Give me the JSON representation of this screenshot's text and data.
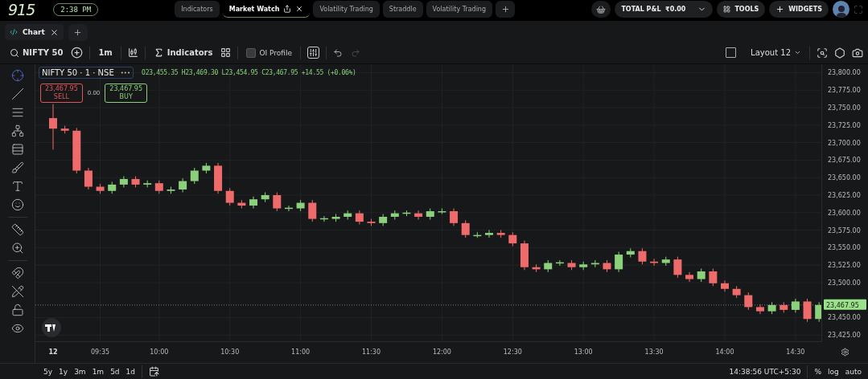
{
  "top_bar": {
    "logo": "915",
    "clock": "2:38 PM",
    "tabs": [
      {
        "label": "Indicators",
        "selected": false
      },
      {
        "label": "Market Watch",
        "selected": true
      },
      {
        "label": "Volatility Trading",
        "selected": false
      },
      {
        "label": "Straddle",
        "selected": false
      },
      {
        "label": "Volatility Trading",
        "selected": false
      }
    ],
    "pnl": {
      "label": "TOTAL P&L",
      "value": "₹0.00"
    },
    "tools": "TOOLS",
    "widgets": "WIDGETS"
  },
  "chart_tabs": [
    {
      "label": "Chart",
      "selected": true
    }
  ],
  "toolbar": {
    "symbol": "NIFTY 50",
    "interval": "1m",
    "indicators": "Indicators",
    "oi_profile": {
      "label": "OI Profile",
      "checked": false
    },
    "redo_disabled": true,
    "layout_checkbox": {
      "checked": false
    },
    "layout": "Layout 12"
  },
  "drawing_tools": [
    {
      "selected": true
    },
    {
      "selected": false
    },
    {
      "selected": false
    },
    {
      "selected": false
    },
    {
      "selected": false
    },
    {
      "selected": false
    },
    {
      "selected": false
    },
    {
      "selected": false
    },
    {
      "selected": false
    },
    {
      "selected": false
    },
    {
      "selected": false
    },
    {
      "selected": false
    },
    {
      "selected": false
    },
    {
      "selected": false
    }
  ],
  "legend": {
    "title": "NIFTY 50 · 1 · NSE",
    "more": "•••",
    "ohlc": "O23,455.35 H23,469.30 L23,454.95 C23,467.95 +14.55 (+0.06%)"
  },
  "trade": {
    "sell_price": "23,467.95",
    "sell_label": "SELL",
    "spread": "0.00",
    "buy_price": "23,467.95",
    "buy_label": "BUY"
  },
  "chart_data": {
    "type": "candlestick",
    "grid": true,
    "x": [
      555,
      560,
      565,
      570,
      575,
      580,
      585,
      590,
      595,
      600,
      605,
      610,
      615,
      620,
      625,
      630,
      635,
      640,
      645,
      650,
      655,
      660,
      665,
      670,
      675,
      680,
      685,
      690,
      695,
      700,
      705,
      710,
      715,
      720,
      725,
      730,
      735,
      740,
      745,
      750,
      755,
      760,
      765,
      770,
      775,
      780,
      785,
      790,
      795,
      800,
      805,
      810,
      815,
      820,
      825,
      830,
      835,
      840,
      845,
      850,
      855,
      860,
      865,
      870,
      875,
      880
    ],
    "xlim": [
      547.5,
      881.3
    ],
    "ohlc": [
      [
        23735,
        23755,
        23690,
        23720
      ],
      [
        23720,
        23724,
        23713,
        23717
      ],
      [
        23717,
        23721,
        23656,
        23660
      ],
      [
        23660,
        23664,
        23633,
        23637
      ],
      [
        23637,
        23641,
        23627,
        23631
      ],
      [
        23631,
        23644,
        23627,
        23640
      ],
      [
        23640,
        23652,
        23636,
        23648
      ],
      [
        23648,
        23652,
        23636,
        23640
      ],
      [
        23640,
        23646,
        23636,
        23642
      ],
      [
        23642,
        23646,
        23627,
        23631
      ],
      [
        23631,
        23637,
        23627,
        23633
      ],
      [
        23633,
        23649,
        23629,
        23645
      ],
      [
        23645,
        23664,
        23641,
        23660
      ],
      [
        23660,
        23671,
        23656,
        23667
      ],
      [
        23667,
        23671,
        23627,
        23631
      ],
      [
        23631,
        23635,
        23610,
        23614
      ],
      [
        23614,
        23618,
        23606,
        23610
      ],
      [
        23610,
        23623,
        23606,
        23619
      ],
      [
        23619,
        23629,
        23615,
        23625
      ],
      [
        23625,
        23629,
        23602,
        23606
      ],
      [
        23606,
        23610,
        23602,
        23607
      ],
      [
        23606,
        23618,
        23602,
        23614
      ],
      [
        23614,
        23618,
        23587,
        23591
      ],
      [
        23591,
        23595,
        23587,
        23592
      ],
      [
        23591,
        23598,
        23587,
        23594
      ],
      [
        23594,
        23603,
        23590,
        23599
      ],
      [
        23599,
        23603,
        23583,
        23587
      ],
      [
        23587,
        23591,
        23581,
        23585
      ],
      [
        23585,
        23598,
        23581,
        23594
      ],
      [
        23594,
        23603,
        23590,
        23599
      ],
      [
        23599,
        23603,
        23595,
        23600
      ],
      [
        23599,
        23603,
        23590,
        23594
      ],
      [
        23594,
        23606,
        23590,
        23602
      ],
      [
        23602,
        23606,
        23598,
        23602
      ],
      [
        23602,
        23606,
        23581,
        23585
      ],
      [
        23585,
        23589,
        23564,
        23568
      ],
      [
        23568,
        23572,
        23564,
        23568
      ],
      [
        23568,
        23575,
        23564,
        23571
      ],
      [
        23571,
        23575,
        23564,
        23568
      ],
      [
        23568,
        23572,
        23552,
        23556
      ],
      [
        23556,
        23560,
        23518,
        23522
      ],
      [
        23522,
        23526,
        23515,
        23519
      ],
      [
        23519,
        23532,
        23515,
        23528
      ],
      [
        23528,
        23532,
        23524,
        23529
      ],
      [
        23528,
        23532,
        23518,
        23522
      ],
      [
        23522,
        23530,
        23518,
        23526
      ],
      [
        23526,
        23532,
        23522,
        23528
      ],
      [
        23528,
        23532,
        23515,
        23519
      ],
      [
        23519,
        23544,
        23515,
        23540
      ],
      [
        23540,
        23549,
        23536,
        23545
      ],
      [
        23545,
        23549,
        23526,
        23530
      ],
      [
        23530,
        23534,
        23524,
        23528
      ],
      [
        23528,
        23537,
        23524,
        23533
      ],
      [
        23533,
        23537,
        23507,
        23511
      ],
      [
        23511,
        23515,
        23501,
        23505
      ],
      [
        23505,
        23520,
        23501,
        23516
      ],
      [
        23516,
        23520,
        23495,
        23499
      ],
      [
        23499,
        23503,
        23487,
        23491
      ],
      [
        23491,
        23495,
        23478,
        23482
      ],
      [
        23482,
        23486,
        23461,
        23465
      ],
      [
        23465,
        23469,
        23455,
        23459
      ],
      [
        23459,
        23472,
        23455,
        23468
      ],
      [
        23468,
        23472,
        23457,
        23461
      ],
      [
        23461,
        23477,
        23457,
        23473
      ],
      [
        23473,
        23477,
        23444,
        23448
      ],
      [
        23448,
        23472,
        23444,
        23468
      ]
    ],
    "ylim": [
      23415,
      23812
    ],
    "xticks": [
      {
        "value": 575,
        "label": "09:35"
      },
      {
        "value": 600,
        "label": "10:00"
      },
      {
        "value": 630,
        "label": "10:30"
      },
      {
        "value": 660,
        "label": "11:00"
      },
      {
        "value": 690,
        "label": "11:30"
      },
      {
        "value": 720,
        "label": "12:00"
      },
      {
        "value": 750,
        "label": "12:30"
      },
      {
        "value": 780,
        "label": "13:00"
      },
      {
        "value": 810,
        "label": "13:30"
      },
      {
        "value": 840,
        "label": "14:00"
      },
      {
        "value": 870,
        "label": "14:30"
      }
    ],
    "yticks": [
      {
        "value": 23800,
        "label": "23,800.00"
      },
      {
        "value": 23775,
        "label": "23,775.00"
      },
      {
        "value": 23750,
        "label": "23,750.00"
      },
      {
        "value": 23725,
        "label": "23,725.00"
      },
      {
        "value": 23700,
        "label": "23,700.00"
      },
      {
        "value": 23675,
        "label": "23,675.00"
      },
      {
        "value": 23650,
        "label": "23,650.00"
      },
      {
        "value": 23625,
        "label": "23,625.00"
      },
      {
        "value": 23600,
        "label": "23,600.00"
      },
      {
        "value": 23575,
        "label": "23,575.00"
      },
      {
        "value": 23550,
        "label": "23,550.00"
      },
      {
        "value": 23525,
        "label": "23,525.00"
      },
      {
        "value": 23500,
        "label": "23,500.00"
      },
      {
        "value": 23450,
        "label": "23,450.00"
      },
      {
        "value": 23425,
        "label": "23,425.00"
      }
    ],
    "ref_lines": [
      {
        "axis": "y",
        "value": 23467.95,
        "label": "23,467.95"
      }
    ]
  },
  "day_label": "12",
  "bottom_bar": {
    "ranges": [
      "5y",
      "1y",
      "3m",
      "1m",
      "5d",
      "1d"
    ],
    "clock": "14:38:56 UTC+5:30",
    "options": [
      "%",
      "log",
      "auto"
    ]
  }
}
